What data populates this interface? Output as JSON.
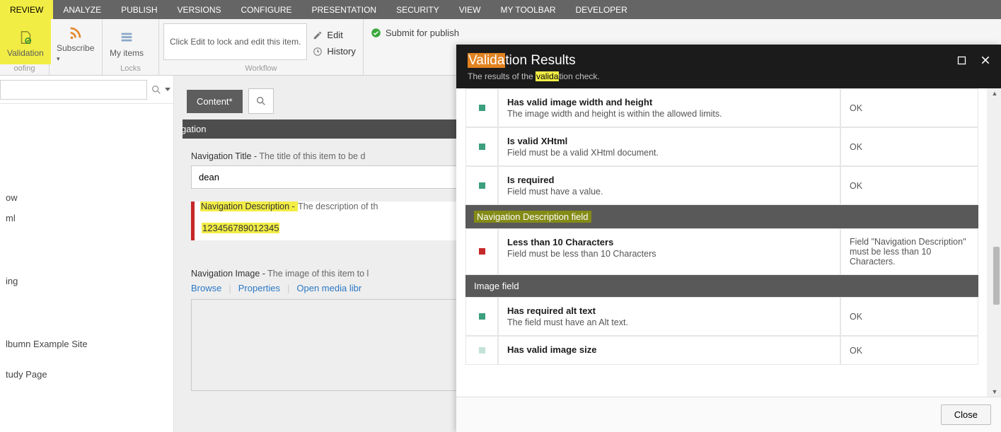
{
  "ribbon": {
    "tabs": [
      "REVIEW",
      "ANALYZE",
      "PUBLISH",
      "VERSIONS",
      "CONFIGURE",
      "PRESENTATION",
      "SECURITY",
      "VIEW",
      "MY TOOLBAR",
      "DEVELOPER"
    ],
    "active_tab": "REVIEW",
    "groups": {
      "proofing": {
        "label": "oofing",
        "buttons": {
          "validation": "Validation"
        }
      },
      "subscribe": {
        "label": "Subscribe"
      },
      "locks": {
        "label": "Locks",
        "myitems": "My items"
      },
      "edit_notice": "Click Edit to lock and edit this item.",
      "workflow": {
        "label": "Workflow",
        "edit": "Edit",
        "history": "History"
      },
      "publish": {
        "submit": "Submit for publish"
      }
    }
  },
  "tree": {
    "items": [
      "ow",
      "ml",
      "",
      "ing",
      "",
      "lbumn Example Site",
      "",
      "tudy Page"
    ]
  },
  "content": {
    "tab_label": "Content*",
    "section_header": "Navigation",
    "fields": {
      "nav_title": {
        "label_a": "Navigation Title - ",
        "label_b": "The title of this item to be d",
        "value": "dean"
      },
      "nav_desc": {
        "label_a": "Navigation Description - ",
        "label_b": "The description of th",
        "value": "123456789012345"
      },
      "nav_image": {
        "label_a": "Navigation Image - ",
        "label_b": "The image of this item to l",
        "links": {
          "browse": "Browse",
          "properties": "Properties",
          "open": "Open media libr"
        }
      }
    }
  },
  "modal": {
    "title_a": "Valida",
    "title_b": "tion Results",
    "subtitle_a": "The results of the ",
    "subtitle_hl": "valida",
    "subtitle_b": "tion check.",
    "close_label": "Close",
    "groups": [
      {
        "highlight": false,
        "rows": [
          {
            "status": "pass",
            "title": "Has valid image width and height",
            "desc": "The image width and height is within the allowed limits.",
            "result": "OK"
          },
          {
            "status": "pass",
            "title": "Is valid XHtml",
            "desc": "Field must be a valid XHtml document.",
            "result": "OK"
          },
          {
            "status": "pass",
            "title": "Is required",
            "desc": "Field must have a value.",
            "result": "OK"
          }
        ]
      },
      {
        "header": "Navigation Description field",
        "highlight": true,
        "rows": [
          {
            "status": "fail",
            "title": "Less than 10 Characters",
            "desc": "Field must be less than 10 Characters",
            "result": "Field \"Navigation Description\" must be less than 10 Characters."
          }
        ]
      },
      {
        "header": "Image field",
        "highlight": false,
        "rows": [
          {
            "status": "pass",
            "title": "Has required alt text",
            "desc": "The field must have an Alt text.",
            "result": "OK"
          },
          {
            "status": "pass",
            "title": "Has valid image size",
            "desc": "",
            "result": "OK"
          }
        ]
      }
    ]
  }
}
